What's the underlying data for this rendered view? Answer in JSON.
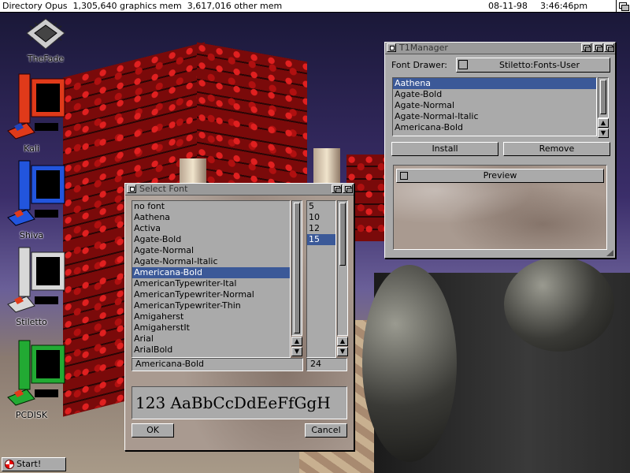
{
  "screen": {
    "title": "Directory Opus  1,305,640 graphics mem  3,617,016 other mem",
    "date": "08-11-98",
    "time": "3:46:46pm"
  },
  "icons": [
    {
      "label": "TheFade",
      "icon": "chip-icon"
    },
    {
      "label": "Kali",
      "icon": "computer-icon",
      "color": "#e03a1a"
    },
    {
      "label": "Shiva",
      "icon": "computer-icon",
      "color": "#2255dd"
    },
    {
      "label": "Stiletto",
      "icon": "computer-icon",
      "color": "#d8d8d8"
    },
    {
      "label": "PCDISK",
      "icon": "computer-icon",
      "color": "#22aa33"
    }
  ],
  "start_label": "Start!",
  "t1manager": {
    "title": "T1Manager",
    "font_drawer_label": "Font Drawer:",
    "font_drawer_value": "Stiletto:Fonts-User",
    "fonts": [
      "Aathena",
      "Agate-Bold",
      "Agate-Normal",
      "Agate-Normal-Italic",
      "Americana-Bold"
    ],
    "selected_index": 0,
    "install_label": "Install",
    "remove_label": "Remove",
    "preview_label": "Preview"
  },
  "select_font": {
    "title": "Select Font",
    "fonts": [
      "no font",
      "Aathena",
      "Activa",
      "Agate-Bold",
      "Agate-Normal",
      "Agate-Normal-Italic",
      "Americana-Bold",
      "AmericanTypewriter-Ital",
      "AmericanTypewriter-Normal",
      "AmericanTypewriter-Thin",
      "Amigaherst",
      "AmigaherstIt",
      "Arial",
      "ArialBold"
    ],
    "selected_index": 6,
    "sizes": [
      "5",
      "10",
      "12",
      "15"
    ],
    "selected_size_index": 3,
    "font_field": "Americana-Bold",
    "size_field": "24",
    "sample_text": "123 AaBbCcDdEeFfGgH",
    "ok_label": "OK",
    "cancel_label": "Cancel"
  }
}
